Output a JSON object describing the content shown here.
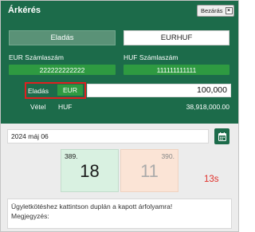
{
  "window": {
    "title": "Árkérés",
    "close_label": "Bezárás",
    "close_glyph": "×"
  },
  "toggle": {
    "sell_label": "Eladás",
    "pair_label": "EURHUF"
  },
  "accounts": {
    "eur_label": "EUR Számlaszám",
    "eur_value": "222222222222",
    "huf_label": "HUF Számlaszám",
    "huf_value": "111111111111"
  },
  "sell": {
    "label": "Eladás",
    "currency": "EUR",
    "amount": "100,000"
  },
  "buy": {
    "label": "Vétel",
    "currency": "HUF",
    "amount": "38,918,000.00"
  },
  "date": {
    "value": "2024 máj 06",
    "icon": "calendar-icon"
  },
  "quotes": {
    "buy_prefix": "389.",
    "buy_big": "18",
    "sell_prefix": "390.",
    "sell_big": "11"
  },
  "timer": "13s",
  "note": {
    "line1": "Ügyletkötéshez kattintson duplán a kapott árfolyamra!",
    "line2": "Megjegyzés:"
  },
  "colors": {
    "header_green": "#1c6b4a",
    "pill_green": "#2e9a41",
    "highlight_red": "#e02020",
    "timer_red": "#e0302a"
  }
}
